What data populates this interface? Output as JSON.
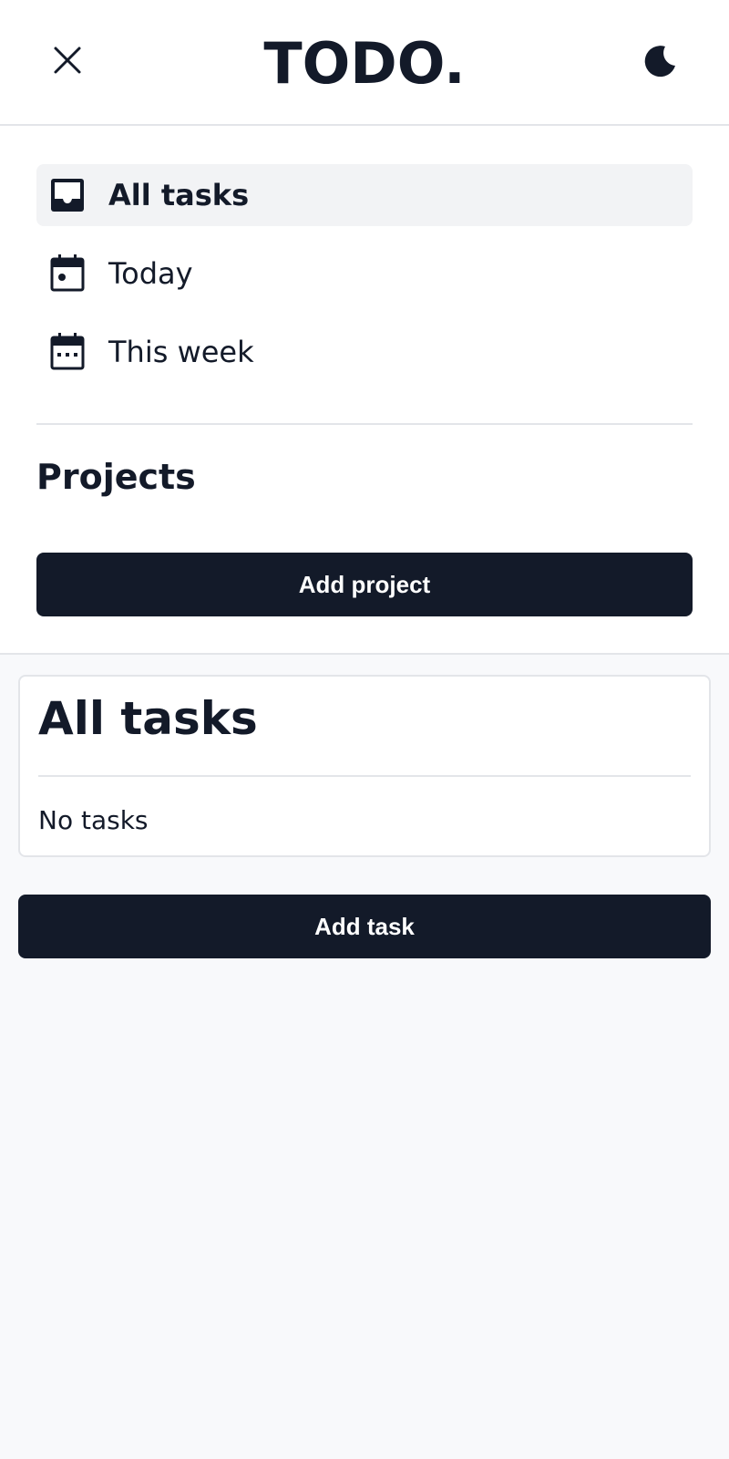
{
  "header": {
    "title": "TODO.",
    "close_icon": "close-icon",
    "theme_icon": "moon-icon"
  },
  "sidebar": {
    "items": [
      {
        "label": "All tasks",
        "icon": "inbox-icon",
        "active": true
      },
      {
        "label": "Today",
        "icon": "calendar-day-icon",
        "active": false
      },
      {
        "label": "This week",
        "icon": "calendar-week-icon",
        "active": false
      }
    ],
    "projects_heading": "Projects",
    "add_project_label": "Add project"
  },
  "main": {
    "title": "All tasks",
    "empty_text": "No tasks",
    "add_task_label": "Add task"
  },
  "colors": {
    "primary": "#131a29",
    "background": "#f8f9fb",
    "surface": "#ffffff",
    "border": "#e3e5e9",
    "active_item": "#f2f3f5"
  }
}
